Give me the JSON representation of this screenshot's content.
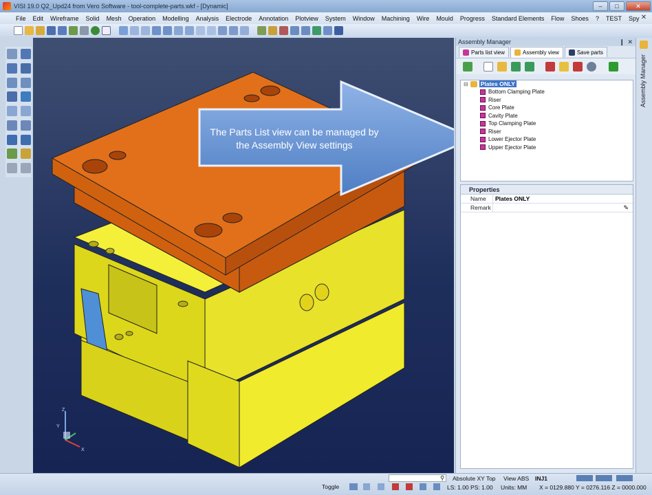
{
  "window": {
    "title": "VISI 19.0 Q2_Upd24 from Vero Software - tool-complete-parts.wkf - [Dynamic]",
    "controls": [
      "–",
      "□",
      "✕"
    ]
  },
  "menu": {
    "items": [
      "File",
      "Edit",
      "Wireframe",
      "Solid",
      "Mesh",
      "Operation",
      "Modelling",
      "Analysis",
      "Electrode",
      "Annotation",
      "Plotview",
      "System",
      "Window",
      "Machining",
      "Wire",
      "Mould",
      "Progress",
      "Standard Elements",
      "Flow",
      "Shoes",
      "?",
      "TEST",
      "Spy"
    ],
    "close": "✕"
  },
  "callout": {
    "text": "The Parts List view can be managed by the Assembly View settings"
  },
  "axes": {
    "z": "Z",
    "y": "Y",
    "x": "X"
  },
  "assembly_manager": {
    "title": "Assembly Manager",
    "pin": "❙",
    "close": "✕",
    "tabs": [
      "Parts list view",
      "Assembly view",
      "Save parts"
    ],
    "tree": {
      "root": "Plates ONLY",
      "items": [
        "Bottom Clamping Plate",
        "Riser",
        "Core Plate",
        "Cavity Plate",
        "Top Clamping Plate",
        "Riser",
        "Lower Ejector Plate",
        "Upper Ejector Plate"
      ]
    },
    "properties": {
      "title": "Properties",
      "rows": [
        {
          "key": "Name",
          "value": "Plates ONLY"
        },
        {
          "key": "Remark",
          "value": ""
        }
      ]
    }
  },
  "side_tab": {
    "label": "Assembly Manager"
  },
  "status": {
    "toggle": "Toggle",
    "ls_ps": "LS: 1.00 PS: 1.00",
    "units": "Units: MM",
    "view_mode": "Absolute XY Top",
    "view_abs": "View ABS",
    "inj": "INJ1",
    "coords": "X = 0129.880 Y = 0276.116 Z = 0000.000"
  },
  "colors": {
    "orange_plate": "#e2701a",
    "yellow_plate": "#f2ee2a",
    "blue_riser": "#4f8fd6",
    "callout_arrow": "#6d97d4",
    "tree_highlight": "#3b73c9",
    "part_icon": "#c8359a"
  }
}
